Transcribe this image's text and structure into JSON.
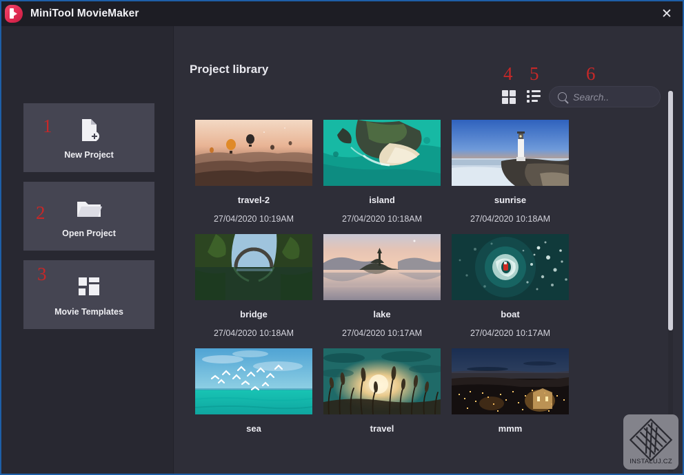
{
  "window": {
    "title": "MiniTool MovieMaker",
    "logo_icon": "moviemaker-logo-icon",
    "close_label": "✕",
    "accent_border": "#1e5fa8"
  },
  "sidebar": {
    "buttons": [
      {
        "label": "New Project",
        "icon": "new-document-plus-icon",
        "annotation": "1"
      },
      {
        "label": "Open Project",
        "icon": "folder-open-icon",
        "annotation": "2"
      },
      {
        "label": "Movie Templates",
        "icon": "templates-grid-icon",
        "annotation": "3"
      }
    ]
  },
  "main": {
    "title": "Project library",
    "toolbar": {
      "grid_view": {
        "icon": "grid-view-icon",
        "annotation": "4"
      },
      "list_view": {
        "icon": "list-view-icon",
        "annotation": "5"
      },
      "search": {
        "icon": "search-icon",
        "placeholder": "Search..",
        "value": "",
        "annotation": "6"
      }
    },
    "projects": [
      {
        "name": "travel-2",
        "date": "27/04/2020  10:19AM",
        "thumb": "balloons-sunrise"
      },
      {
        "name": "island",
        "date": "27/04/2020  10:18AM",
        "thumb": "aerial-island-beach"
      },
      {
        "name": "sunrise",
        "date": "27/04/2020  10:18AM",
        "thumb": "lighthouse-sunrise"
      },
      {
        "name": "bridge",
        "date": "27/04/2020  10:18AM",
        "thumb": "arch-bridge-reflection"
      },
      {
        "name": "lake",
        "date": "27/04/2020  10:17AM",
        "thumb": "lake-island-dawn"
      },
      {
        "name": "boat",
        "date": "27/04/2020  10:17AM",
        "thumb": "red-boat-swirl"
      },
      {
        "name": "sea",
        "date": "",
        "thumb": "birds-over-sea"
      },
      {
        "name": "travel",
        "date": "",
        "thumb": "wheat-field-sun"
      },
      {
        "name": "mmm",
        "date": "",
        "thumb": "night-city-lights"
      }
    ]
  },
  "watermark": {
    "text": "INSTALUJ.CZ",
    "icon": "instaluj-diamond-icon"
  }
}
